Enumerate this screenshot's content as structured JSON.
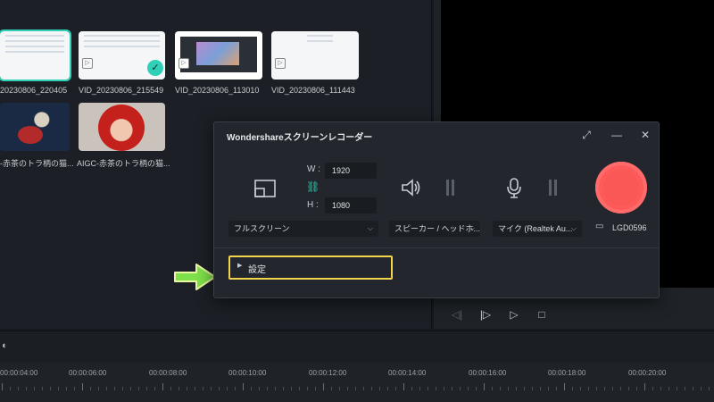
{
  "media": {
    "items": [
      {
        "label": "20230806_220405"
      },
      {
        "label": "VID_20230806_215549"
      },
      {
        "label": "VID_20230806_113010"
      },
      {
        "label": "VID_20230806_111443"
      },
      {
        "label": "-赤茶のトラ柄の猫..."
      },
      {
        "label": "AIGC-赤茶のトラ柄の猫..."
      }
    ]
  },
  "recorder": {
    "title": "Wondershareスクリーンレコーダー",
    "width_label": "W :",
    "width_value": "1920",
    "height_label": "H :",
    "height_value": "1080",
    "area_mode": "フルスクリーン",
    "speaker": "スピーカー / ヘッドホ...",
    "mic": "マイク (Realtek Au...",
    "monitor": "LGD0596",
    "settings_label": "設定"
  },
  "timeline": {
    "ticks": [
      "00:00:04:00",
      "00:00:06:00",
      "00:00:08:00",
      "00:00:10:00",
      "00:00:12:00",
      "00:00:14:00",
      "00:00:16:00",
      "00:00:18:00",
      "00:00:20:00"
    ]
  },
  "colors": {
    "accent": "#2fd0b5",
    "record": "#ff5a5a",
    "highlight": "#f2d54a",
    "arrow": "#7ee04a"
  }
}
